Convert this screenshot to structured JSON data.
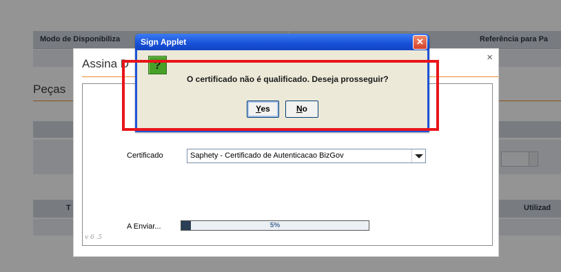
{
  "background": {
    "header_col1": "Modo de Disponibiliza",
    "header_col2": "Referência para Pa",
    "section_title": "Peças",
    "table_col_left": "T",
    "table_col_right": "Utilizad"
  },
  "modal": {
    "title": "Assina D",
    "close_glyph": "×",
    "certificate_label": "Certificado",
    "certificate_value": "Saphety - Certificado de Autenticacao BizGov",
    "send_label": "A Enviar...",
    "progress_percent": 5,
    "progress_text": "5%",
    "version": "v 6 .5"
  },
  "dialog": {
    "title": "Sign Applet",
    "close_glyph": "✕",
    "icon_glyph": "?",
    "message": "O certificado não é qualificado. Deseja prosseguir?",
    "yes_label": "Yes",
    "no_label": "No"
  },
  "colors": {
    "highlight": "#e8141a",
    "accent_orange": "#e88a2a",
    "dialog_blue": "#1f53d8",
    "icon_green": "#47a128"
  }
}
